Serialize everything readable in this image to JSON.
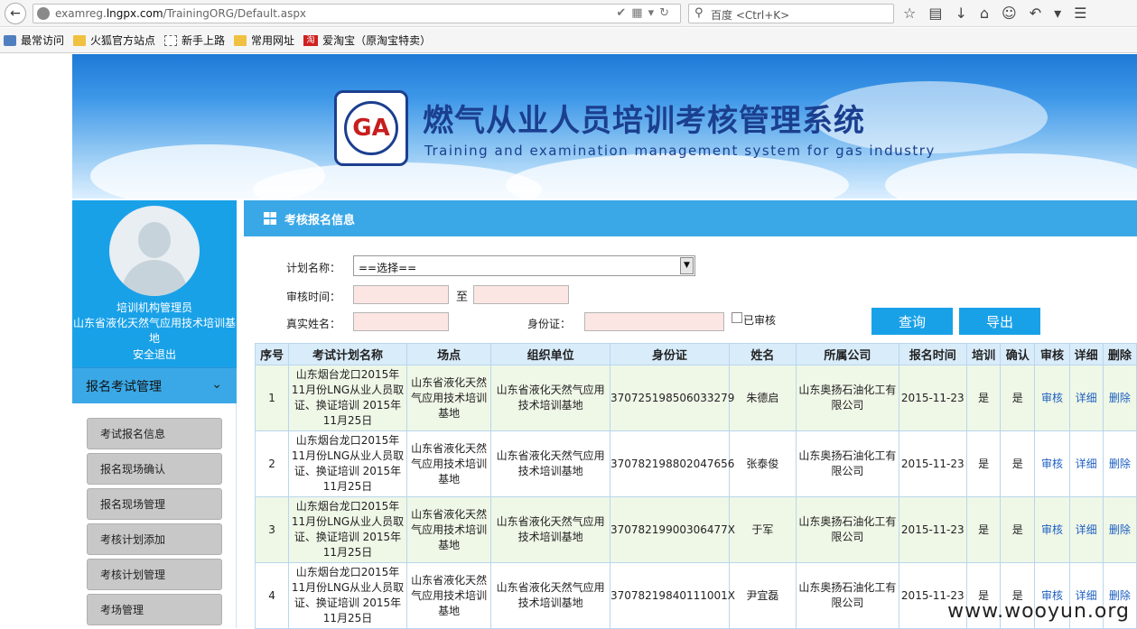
{
  "browser": {
    "url_prefix": "examreg.",
    "url_domain": "lngpx.com",
    "url_path": "/TrainingORG/Default.aspx",
    "search_placeholder": "百度 <Ctrl+K>",
    "bookmarks": [
      "最常访问",
      "火狐官方站点",
      "新手上路",
      "常用网址",
      "爱淘宝（原淘宝特卖）"
    ]
  },
  "banner": {
    "title_cn": "燃气从业人员培训考核管理系统",
    "title_en": "Training and examination management system for gas industry"
  },
  "sidebar": {
    "role": "培训机构管理员",
    "org": "山东省液化天然气应用技术培训基地",
    "logout": "安全退出",
    "menu_head": "报名考试管理",
    "items": [
      "考试报名信息",
      "报名现场确认",
      "报名现场管理",
      "考核计划添加",
      "考核计划管理",
      "考场管理"
    ]
  },
  "main": {
    "title": "考核报名信息",
    "form": {
      "plan_label": "计划名称：",
      "plan_value": "==选择==",
      "time_label": "审核时间：",
      "to_label": "至",
      "name_label": "真实姓名：",
      "id_label": "身份证：",
      "checked_label": "已审核",
      "query_btn": "查询",
      "export_btn": "导出"
    },
    "columns": [
      "序号",
      "考试计划名称",
      "场点",
      "组织单位",
      "身份证",
      "姓名",
      "所属公司",
      "报名时间",
      "培训",
      "确认",
      "审核",
      "详细",
      "删除"
    ],
    "rows": [
      {
        "no": "1",
        "plan": "山东烟台龙口2015年11月份LNG从业人员取证、换证培训 2015年11月25日",
        "site": "山东省液化天然气应用技术培训基地",
        "org": "山东省液化天然气应用技术培训基地",
        "id": "370725198506033279",
        "name": "朱德启",
        "company": "山东奥扬石油化工有限公司",
        "date": "2015-11-23",
        "train": "是",
        "confirm": "是",
        "audit": "审核",
        "detail": "详细",
        "del": "删除"
      },
      {
        "no": "2",
        "plan": "山东烟台龙口2015年11月份LNG从业人员取证、换证培训 2015年11月25日",
        "site": "山东省液化天然气应用技术培训基地",
        "org": "山东省液化天然气应用技术培训基地",
        "id": "370782198802047656",
        "name": "张泰俊",
        "company": "山东奥扬石油化工有限公司",
        "date": "2015-11-23",
        "train": "是",
        "confirm": "是",
        "audit": "审核",
        "detail": "详细",
        "del": "删除"
      },
      {
        "no": "3",
        "plan": "山东烟台龙口2015年11月份LNG从业人员取证、换证培训 2015年11月25日",
        "site": "山东省液化天然气应用技术培训基地",
        "org": "山东省液化天然气应用技术培训基地",
        "id": "37078219900306477X",
        "name": "于军",
        "company": "山东奥扬石油化工有限公司",
        "date": "2015-11-23",
        "train": "是",
        "confirm": "是",
        "audit": "审核",
        "detail": "详细",
        "del": "删除"
      },
      {
        "no": "4",
        "plan": "山东烟台龙口2015年11月份LNG从业人员取证、换证培训 2015年11月25日",
        "site": "山东省液化天然气应用技术培训基地",
        "org": "山东省液化天然气应用技术培训基地",
        "id": "37078219840111001X",
        "name": "尹宜磊",
        "company": "山东奥扬石油化工有限公司",
        "date": "2015-11-23",
        "train": "是",
        "confirm": "是",
        "audit": "审核",
        "detail": "详细",
        "del": "删除"
      }
    ]
  },
  "watermark": "www.wooyun.org"
}
